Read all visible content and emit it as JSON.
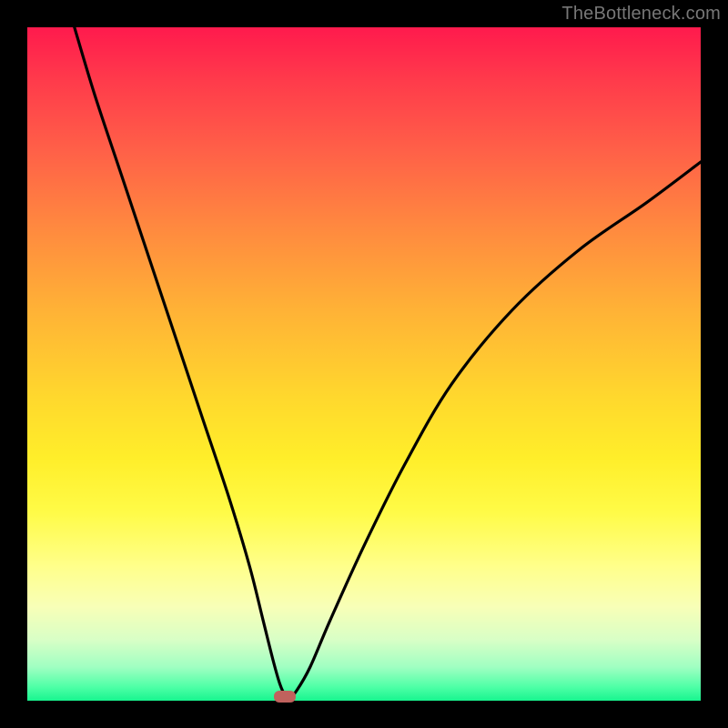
{
  "watermark": "TheBottleneck.com",
  "chart_data": {
    "type": "line",
    "title": "",
    "xlabel": "",
    "ylabel": "",
    "xlim": [
      0,
      100
    ],
    "ylim": [
      0,
      100
    ],
    "series": [
      {
        "name": "curve",
        "x": [
          7,
          10,
          14,
          18,
          22,
          26,
          30,
          33,
          35,
          36.5,
          37.5,
          38.3,
          39,
          40,
          42,
          45,
          50,
          56,
          63,
          72,
          82,
          92,
          100
        ],
        "values": [
          100,
          90,
          78,
          66,
          54,
          42,
          30,
          20,
          12,
          6,
          2.5,
          0.8,
          0.5,
          1.5,
          5,
          12,
          23,
          35,
          47,
          58,
          67,
          74,
          80
        ]
      }
    ],
    "marker": {
      "x": 38.3,
      "y": 0.5,
      "color": "#c0625d"
    },
    "background_gradient": {
      "top_color": "#ff1a4d",
      "mid_color": "#ffee2a",
      "bottom_color": "#18f58f"
    }
  }
}
